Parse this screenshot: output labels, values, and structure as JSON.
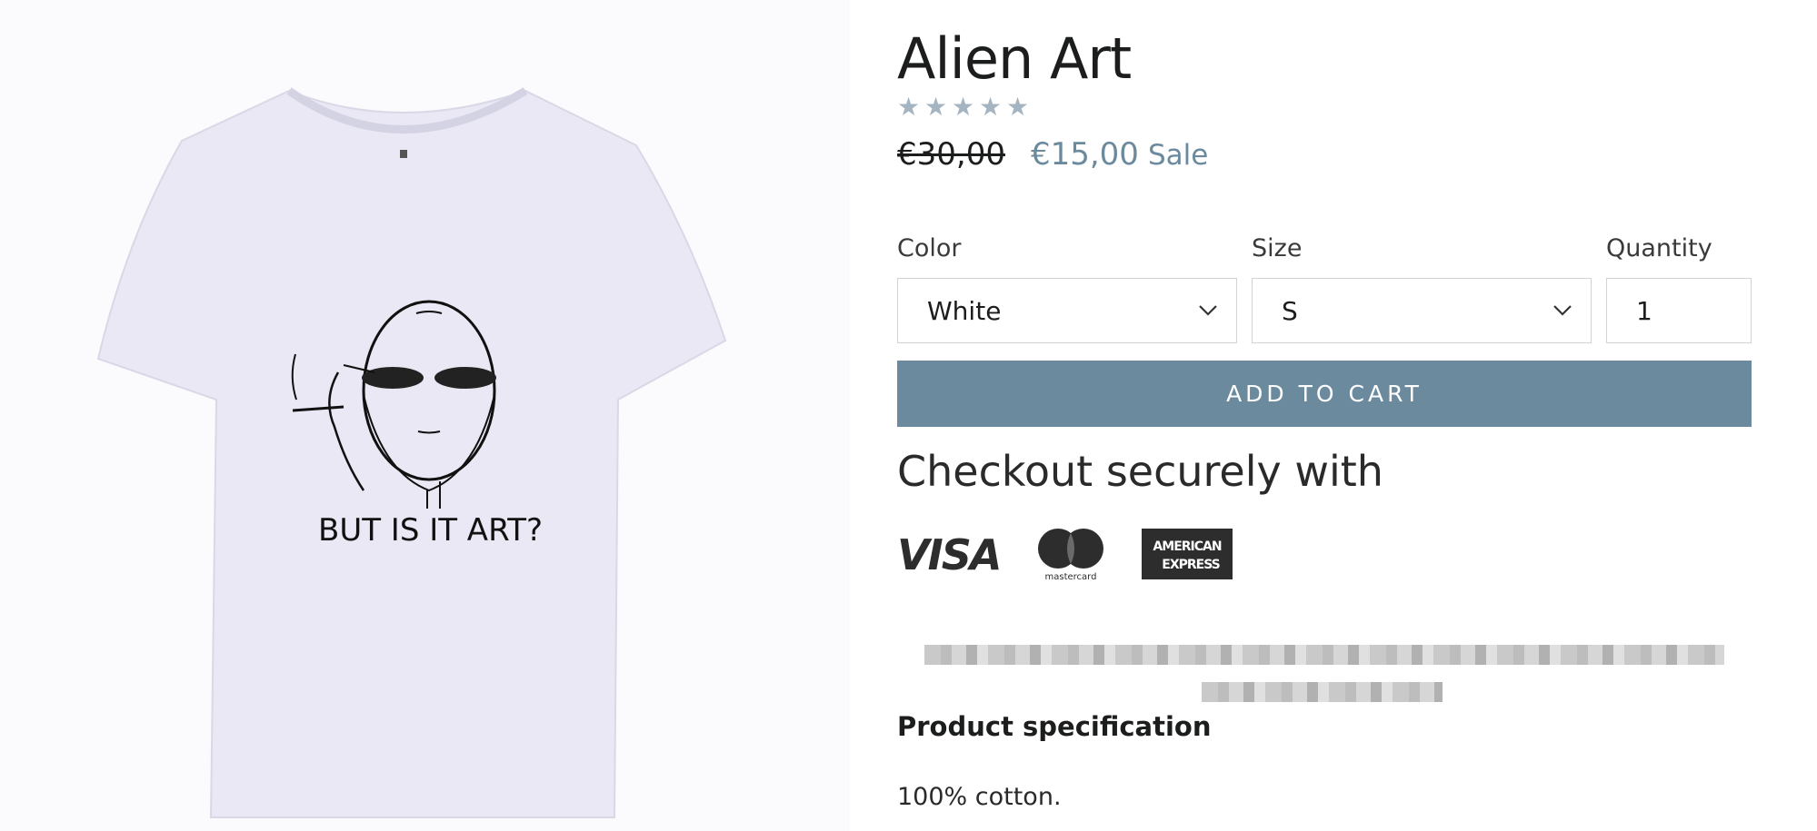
{
  "product": {
    "title": "Alien Art",
    "rating_stars": 5,
    "star_glyph": "★",
    "old_price": "€30,00",
    "sale_price": "€15,00",
    "sale_label": "Sale",
    "print_text": "BUT IS IT ART?"
  },
  "options": {
    "color_label": "Color",
    "color_value": "White",
    "size_label": "Size",
    "size_value": "S",
    "quantity_label": "Quantity",
    "quantity_value": "1"
  },
  "actions": {
    "add_to_cart": "ADD TO CART"
  },
  "checkout": {
    "heading": "Checkout securely with",
    "visa": "VISA",
    "mastercard": "mastercard",
    "amex_line1": "AMERICAN",
    "amex_line2": "EXPRESS"
  },
  "spec": {
    "heading": "Product specification",
    "body": "100% cotton."
  },
  "colors": {
    "accent": "#6b8a9e",
    "stars": "#a4b4c0",
    "text": "#1c1d1d"
  }
}
